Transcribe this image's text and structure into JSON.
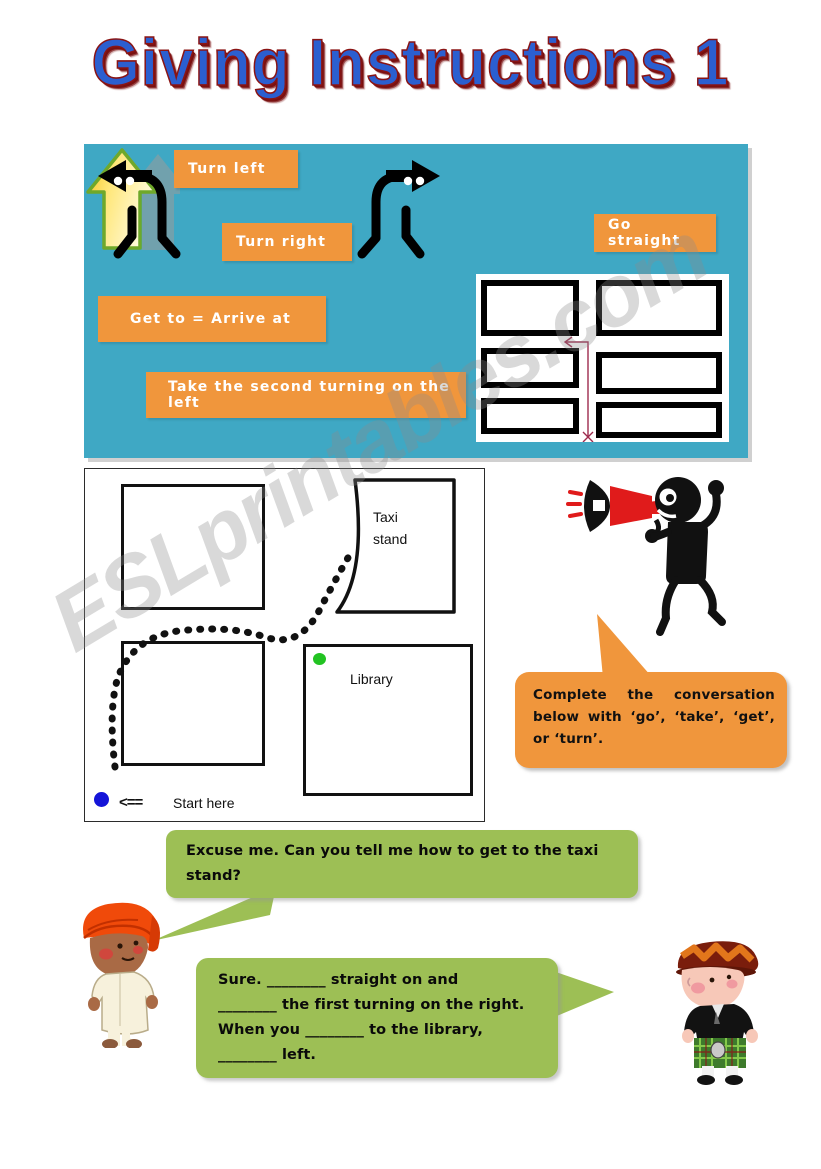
{
  "page": {
    "title": "Giving Instructions 1",
    "watermark": "ESLprintables.com",
    "title_color": "#2B5FD0",
    "title_shadow_color": "#8A1414"
  },
  "blue_panel": {
    "background_color": "#3FA8C4",
    "label_color": "#F0963C",
    "label_text_color": "#FFFFFF",
    "labels": [
      {
        "id": "turn-left",
        "text": "Turn left"
      },
      {
        "id": "turn-right",
        "text": "Turn right"
      },
      {
        "id": "go-straight",
        "text": "Go straight"
      },
      {
        "id": "get-to",
        "text": "Get to = Arrive at"
      },
      {
        "id": "take-second",
        "text": "Take the second turning on the left"
      }
    ],
    "icons": [
      {
        "name": "arrow-left-character",
        "direction": "left"
      },
      {
        "name": "arrow-right-character",
        "direction": "right"
      },
      {
        "name": "arrow-up-yellow",
        "direction": "up",
        "color": "#FFD94A",
        "outline": "#6FA82A"
      }
    ],
    "street_grid": {
      "blocks": 6,
      "route_color": "#9E2B4E",
      "route_description": "route goes up then turns left"
    }
  },
  "map_panel": {
    "taxi_stand_label": "Taxi\nstand",
    "library_label": "Library",
    "start_label": "Start here",
    "start_arrows": "<==",
    "green_dot_color": "#22C322",
    "blue_dot_color": "#1414D8",
    "route_style": "dotted"
  },
  "instruction_bubble": {
    "text": "Complete the conversation below with ‘go’, ‘take’, ‘get’, or ‘turn’.",
    "color": "#F0963C",
    "speaker_icon": "megaphone-icon",
    "megaphone_color": "#E01B1B"
  },
  "conversation": {
    "bubble_color": "#9DBF55",
    "lines": [
      {
        "speaker": "boy-with-turban",
        "text": "Excuse me. Can you tell me how to get to the taxi stand?"
      },
      {
        "speaker": "scottish-boy",
        "text": "Sure. ________ straight on and\n________ the first turning on the right.\nWhen you ________ to the library,\n________ left."
      }
    ]
  }
}
